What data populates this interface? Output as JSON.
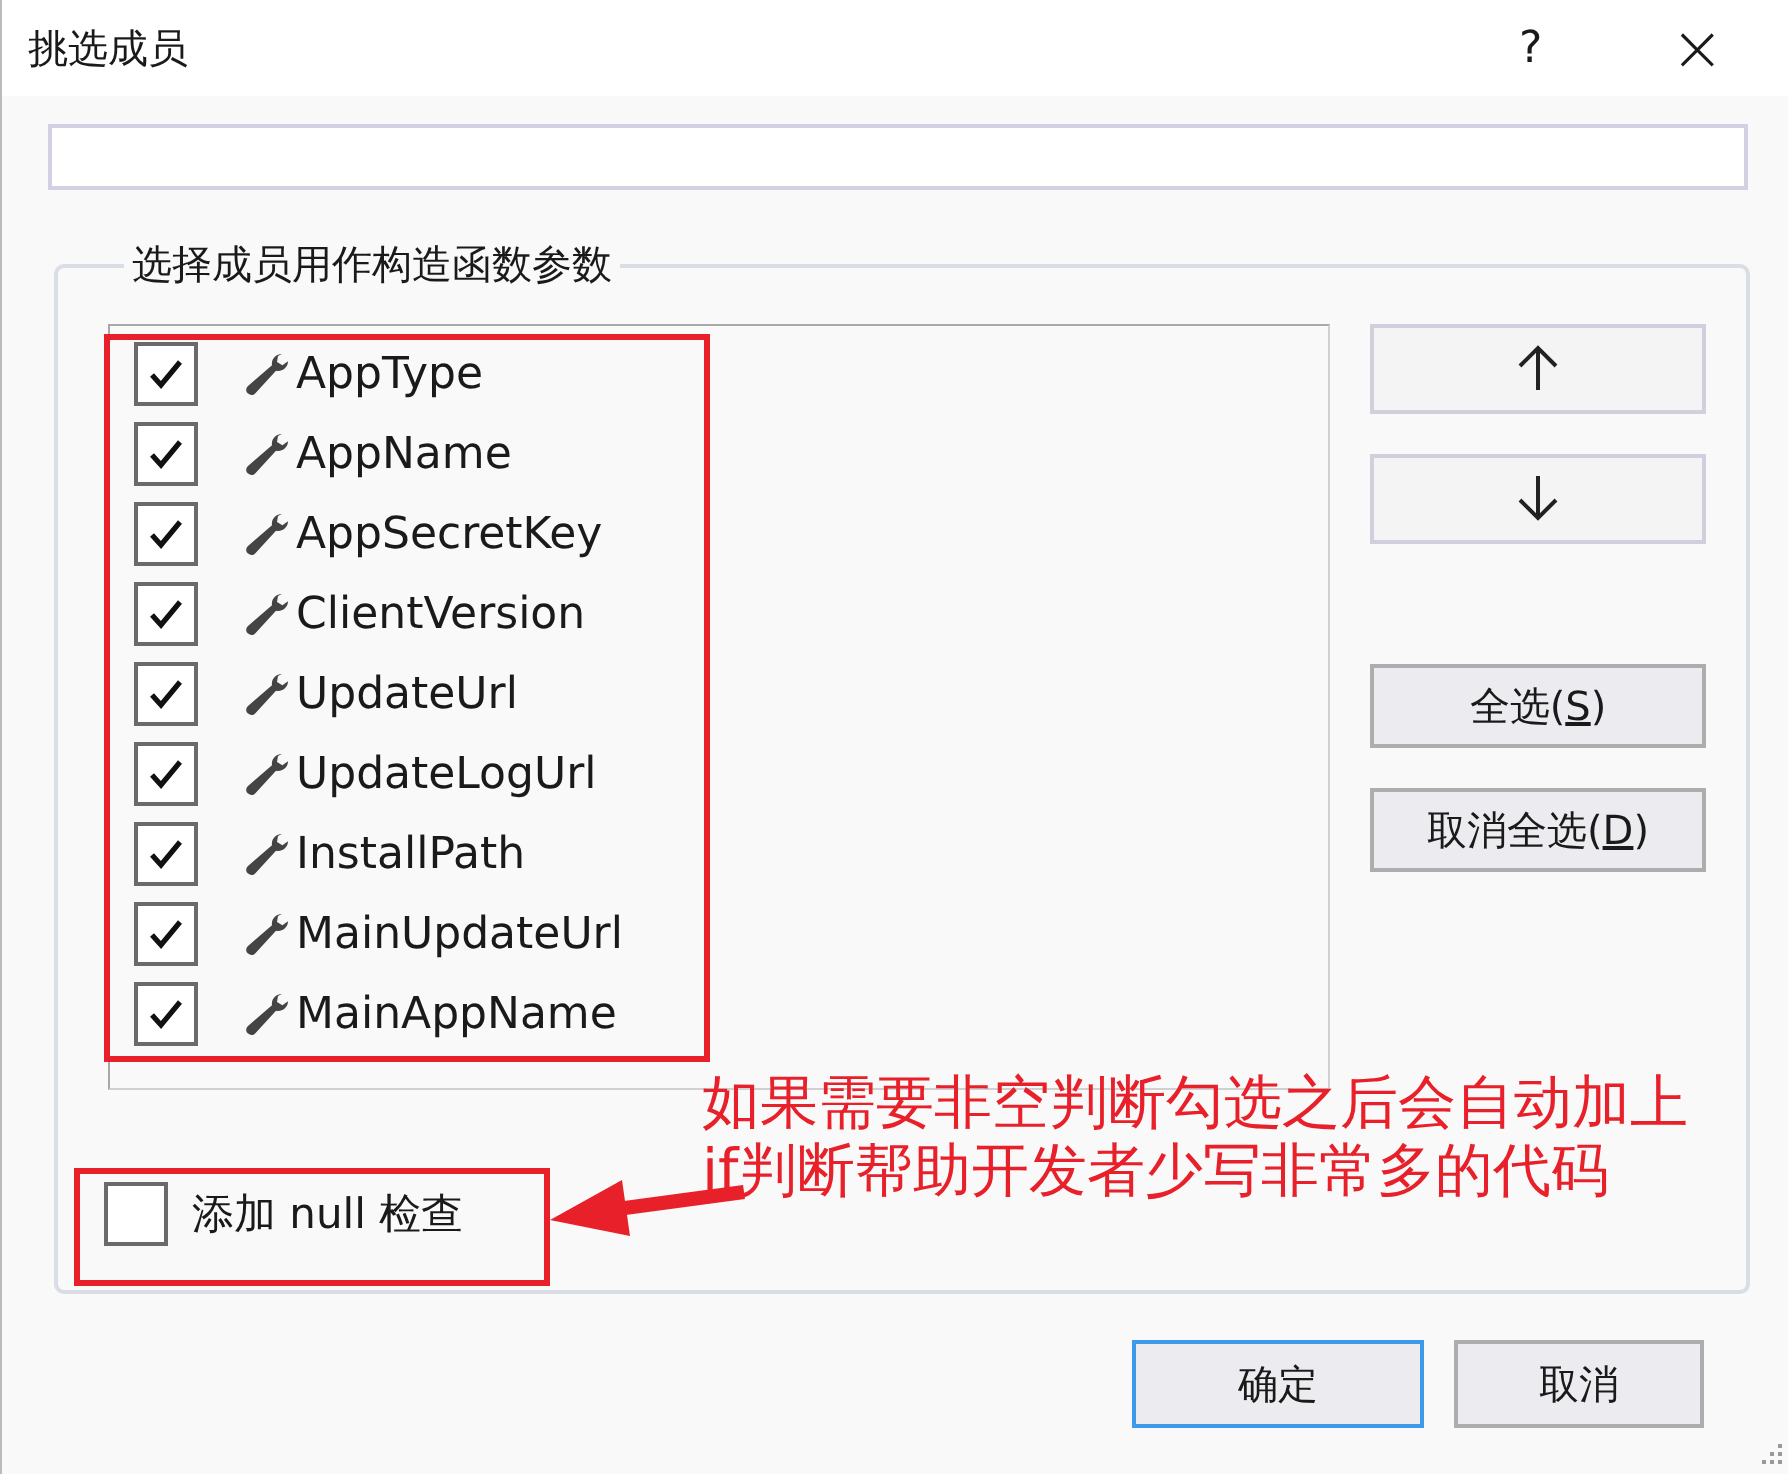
{
  "window": {
    "title": "挑选成员",
    "help": "?",
    "close": "×"
  },
  "filter": {
    "kind": "text"
  },
  "group": {
    "title": "选择成员用作构造函数参数",
    "members": [
      {
        "name": "AppType",
        "checked": true
      },
      {
        "name": "AppName",
        "checked": true
      },
      {
        "name": "AppSecretKey",
        "checked": true
      },
      {
        "name": "ClientVersion",
        "checked": true
      },
      {
        "name": "UpdateUrl",
        "checked": true
      },
      {
        "name": "UpdateLogUrl",
        "checked": true
      },
      {
        "name": "InstallPath",
        "checked": true
      },
      {
        "name": "MainUpdateUrl",
        "checked": true
      },
      {
        "name": "MainAppName",
        "checked": true
      }
    ],
    "side_buttons": [
      {
        "kind": "up"
      },
      {
        "kind": "down"
      },
      {
        "kind": "text",
        "before": "全选(",
        "access_key": "S",
        "after": ")"
      },
      {
        "kind": "text",
        "before": "取消全选(",
        "access_key": "D",
        "after": ")"
      }
    ],
    "null_check": {
      "label": "添加 null 检查",
      "checked": false
    }
  },
  "annotation": {
    "lines": [
      "如果需要非空判断勾选之后会自动加上",
      "if判断帮助开发者少写非常多的代码"
    ]
  },
  "buttons": [
    {
      "label": "确定",
      "default": true
    },
    {
      "label": "取消",
      "default": false
    }
  ]
}
